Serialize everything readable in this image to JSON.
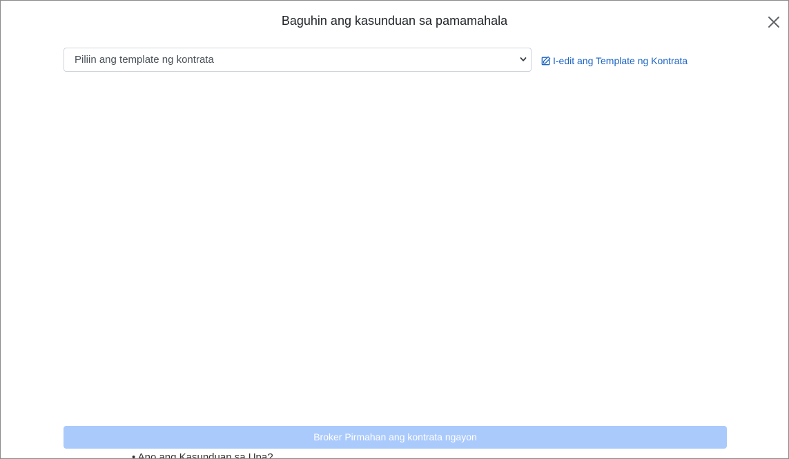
{
  "modal": {
    "title": "Baguhin ang kasunduan sa pamamahala",
    "close_icon": "close-icon"
  },
  "template_select": {
    "selected": "Piliin ang template ng kontrata",
    "caret_icon": "chevron-down-icon"
  },
  "edit_link": {
    "label": "I-edit ang Template ng Kontrata",
    "icon": "edit-icon"
  },
  "content": {
    "clipped_line": "• Ano ang Kasunduan sa Upa?"
  },
  "footer": {
    "sign_button_label": "Broker Pirmahan ang kontrata ngayon"
  },
  "colors": {
    "link": "#1a63c4",
    "button_disabled": "#abcafc",
    "border": "#ced4da"
  }
}
